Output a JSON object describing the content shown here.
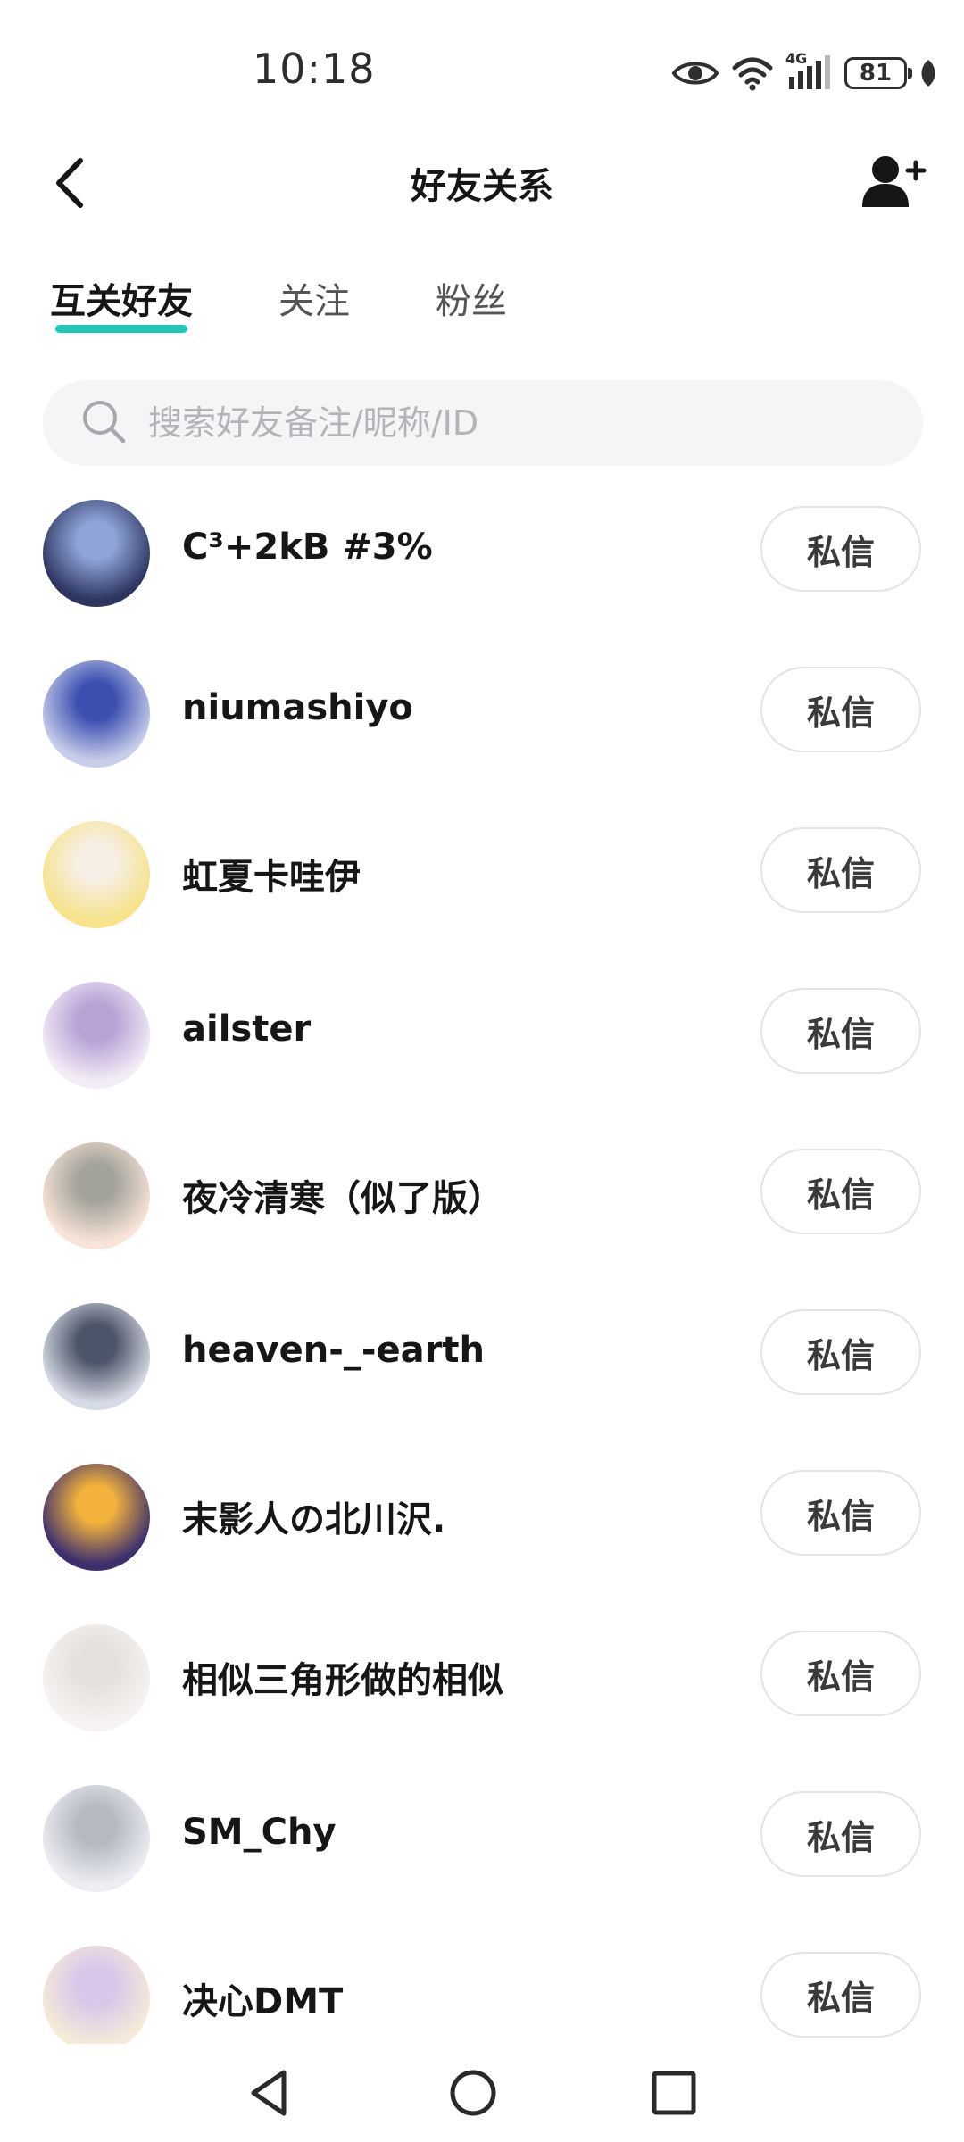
{
  "status_bar": {
    "time": "10:18",
    "network": "4G",
    "battery": "81",
    "icons": [
      "eye-icon",
      "wifi-icon",
      "signal-icon",
      "battery-icon",
      "leaf-icon"
    ]
  },
  "header": {
    "title": "好友关系"
  },
  "tabs": [
    {
      "label": "互关好友",
      "active": true
    },
    {
      "label": "关注",
      "active": false
    },
    {
      "label": "粉丝",
      "active": false
    }
  ],
  "search": {
    "placeholder": "搜索好友备注/昵称/ID",
    "value": ""
  },
  "friends": [
    {
      "name": "C³+2kB #3%",
      "button": "私信",
      "avatar_colors": [
        "#2d3560",
        "#8fa5d8"
      ]
    },
    {
      "name": "niumashiyo",
      "button": "私信",
      "avatar_colors": [
        "#c8cdea",
        "#3b4fb0"
      ]
    },
    {
      "name": "虹夏卡哇伊",
      "button": "私信",
      "avatar_colors": [
        "#f6e38a",
        "#f7efe5"
      ]
    },
    {
      "name": "ailster",
      "button": "私信",
      "avatar_colors": [
        "#f3edf6",
        "#b9a2d6"
      ]
    },
    {
      "name": "夜冷清寒（似了版）",
      "button": "私信",
      "avatar_colors": [
        "#f8e4d8",
        "#a4a39a"
      ]
    },
    {
      "name": "heaven-_-earth",
      "button": "私信",
      "avatar_colors": [
        "#d7dbe5",
        "#4b5468"
      ]
    },
    {
      "name": "末影人の北川沢.",
      "button": "私信",
      "avatar_colors": [
        "#3d2f6e",
        "#f2b23c"
      ]
    },
    {
      "name": "相似三角形做的相似",
      "button": "私信",
      "avatar_colors": [
        "#f6f3f2",
        "#e6e0dc"
      ]
    },
    {
      "name": "SM_Chy",
      "button": "私信",
      "avatar_colors": [
        "#eceef2",
        "#b6b9c2"
      ]
    },
    {
      "name": "决心DMT",
      "button": "私信",
      "avatar_colors": [
        "#f6ebd8",
        "#d9c7ea"
      ]
    }
  ],
  "colors": {
    "accent": "#1fc7b9",
    "text_primary": "#161616",
    "text_secondary": "#555555",
    "search_bg": "#f4f5f7",
    "placeholder": "#b2b4b8",
    "button_border": "#e3e4e8"
  },
  "nav_bar": {
    "buttons": [
      "back-triangle-icon",
      "home-circle-icon",
      "recents-square-icon"
    ]
  }
}
